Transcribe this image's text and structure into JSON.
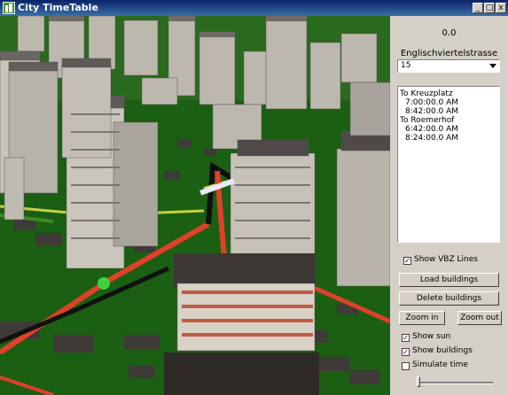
{
  "window": {
    "title": "City TimeTable",
    "minimize": "_",
    "maximize": "□",
    "close": "x"
  },
  "panel": {
    "coords": "0.0",
    "street": "Englischviertelstrasse",
    "line_select": {
      "value": "15"
    },
    "schedule": [
      {
        "text": "To Kreuzplatz",
        "indent": false
      },
      {
        "text": "7:00:00.0 AM",
        "indent": true
      },
      {
        "text": "8:42:00.0 AM",
        "indent": true
      },
      {
        "text": "To Roemerhof",
        "indent": false
      },
      {
        "text": "6:42:00.0 AM",
        "indent": true
      },
      {
        "text": "8:24:00.0 AM",
        "indent": true
      }
    ],
    "show_vbz_lines": {
      "label": "Show VBZ Lines",
      "checked": true
    },
    "load_buildings": "Load buildings",
    "delete_buildings": "Delete buildings",
    "zoom_in": "Zoom in",
    "zoom_out": "Zoom out",
    "show_sun": {
      "label": "Show sun",
      "checked": true
    },
    "show_buildings": {
      "label": "Show buildings",
      "checked": true
    },
    "simulate_time": {
      "label": "Simulate time",
      "checked": false
    },
    "time_slider": {
      "value": 0
    }
  },
  "scene": {
    "ground_color": "#1b5f12",
    "route_red": "#e0402a",
    "route_black": "#101010",
    "route_yellow": "#c8d040",
    "stop_green": "#3cd23c"
  }
}
